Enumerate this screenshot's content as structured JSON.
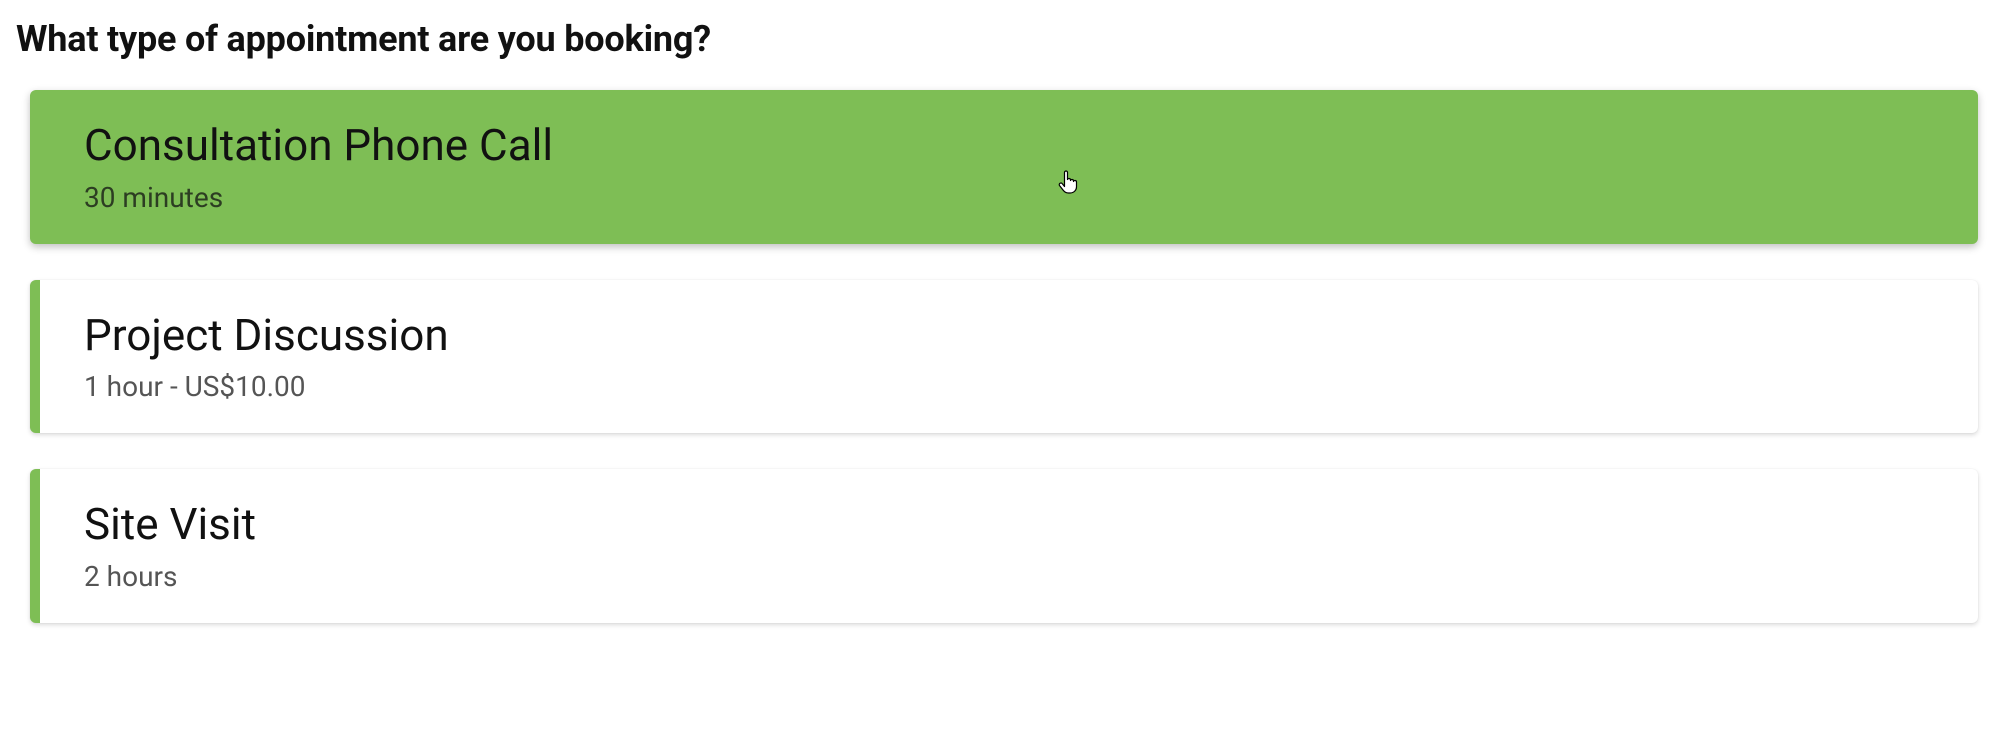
{
  "heading": "What type of appointment are you booking?",
  "accent_color": "#7ebe55",
  "options": [
    {
      "title": "Consultation Phone Call",
      "meta": "30 minutes",
      "selected": true
    },
    {
      "title": "Project Discussion",
      "meta": "1 hour - US$10.00",
      "selected": false
    },
    {
      "title": "Site Visit",
      "meta": "2 hours",
      "selected": false
    }
  ]
}
